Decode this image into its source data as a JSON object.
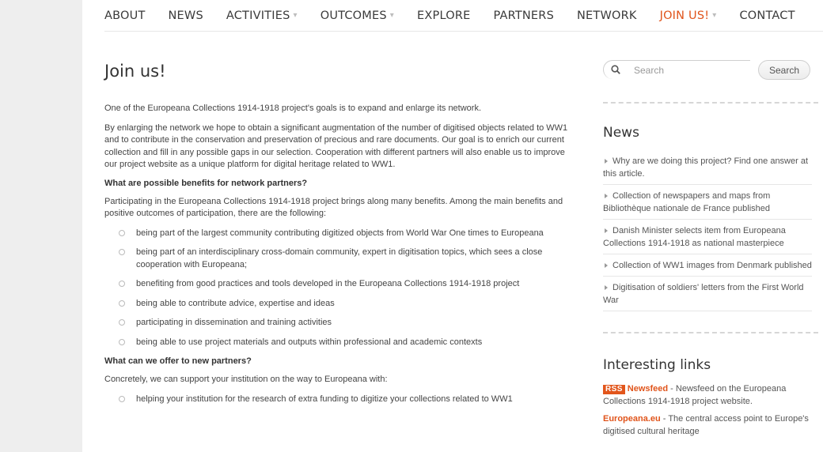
{
  "nav": {
    "items": [
      {
        "label": "ABOUT",
        "caret": ""
      },
      {
        "label": "NEWS",
        "caret": ""
      },
      {
        "label": "ACTIVITIES",
        "caret": "▾"
      },
      {
        "label": "OUTCOMES",
        "caret": "▾"
      },
      {
        "label": "EXPLORE",
        "caret": ""
      },
      {
        "label": "PARTNERS",
        "caret": ""
      },
      {
        "label": "NETWORK",
        "caret": ""
      },
      {
        "label": "JOIN US!",
        "caret": "▾",
        "active": true
      },
      {
        "label": "CONTACT",
        "caret": ""
      }
    ]
  },
  "main": {
    "title": "Join us!",
    "intro": "One of the Europeana Collections 1914-1918 project's goals is to expand and enlarge its network.",
    "para2": "By enlarging the network we hope to obtain a significant augmentation of the number of digitised objects related to WW1 and to contribute in the conservation and preservation of precious and rare documents. Our goal is to enrich our current collection and fill in any possible gaps in our selection. Cooperation with different partners will also enable us to improve our project website as a unique platform for digital heritage related to WW1.",
    "heading1": "What are possible benefits for network partners?",
    "para3": "Participating in the Europeana Collections 1914-1918 project brings along many benefits. Among the main benefits and positive outcomes of participation, there are the following:",
    "benefits": [
      "being part of the largest community contributing digitized objects from World War One times to Europeana",
      "being part of an interdisciplinary cross-domain community, expert in digitisation topics, which sees a close cooperation with Europeana;",
      "benefiting from good practices and tools developed in the Europeana Collections 1914-1918 project",
      "being able to contribute advice, expertise and ideas",
      "participating in dissemination and training activities",
      "being able to use project materials and outputs within professional and academic contexts"
    ],
    "heading2": "What can we offer to new partners?",
    "para4": "Concretely, we can support your institution on the way to Europeana with:",
    "offers": [
      "helping your institution for the research of extra funding to digitize your collections related to WW1"
    ]
  },
  "sidebar": {
    "search_placeholder": "Search",
    "search_button": "Search",
    "news_title": "News",
    "news": [
      "Why are we doing this project? Find one answer at this article.",
      "Collection of newspapers and maps from Bibliothèque nationale de France published",
      "Danish Minister selects item from Europeana Collections 1914-1918 as national masterpiece",
      "Collection of WW1 images from Denmark published",
      "Digitisation of soldiers' letters from the First World War"
    ],
    "links_title": "Interesting links",
    "links": [
      {
        "badge": "RSS",
        "name": "Newsfeed",
        "desc": " - Newsfeed on the Europeana Collections 1914-1918 project website."
      },
      {
        "badge": "",
        "name": "Europeana.eu",
        "desc": " - The central access point to Europe's digitised cultural heritage"
      }
    ]
  },
  "colors": {
    "accent": "#e0541b",
    "text": "#444444",
    "left_strip": "#eeeeee"
  }
}
